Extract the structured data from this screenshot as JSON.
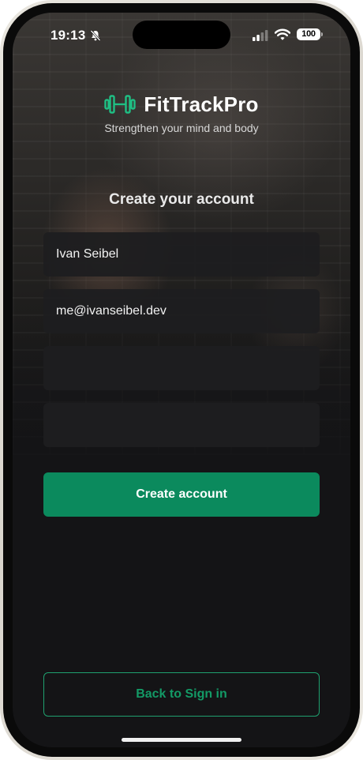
{
  "status_bar": {
    "time": "19:13",
    "battery": "100",
    "icons": [
      "bell-slash-icon",
      "cellular-signal-icon",
      "wifi-icon",
      "battery-icon"
    ]
  },
  "brand": {
    "name": "FitTrackPro",
    "tagline": "Strengthen your mind and body",
    "logo_icon": "dumbbell-icon",
    "accent_color": "#1fbf84"
  },
  "form": {
    "title": "Create your account",
    "name_value": "Ivan Seibel",
    "email_value": "me@ivanseibel.dev",
    "password_value": "",
    "confirm_password_value": "",
    "submit_label": "Create account"
  },
  "footer": {
    "back_label": "Back to Sign in"
  },
  "colors": {
    "primary": "#0b8a5d",
    "outline": "#1fa06f",
    "background": "#141416",
    "field": "#1e1e20"
  }
}
